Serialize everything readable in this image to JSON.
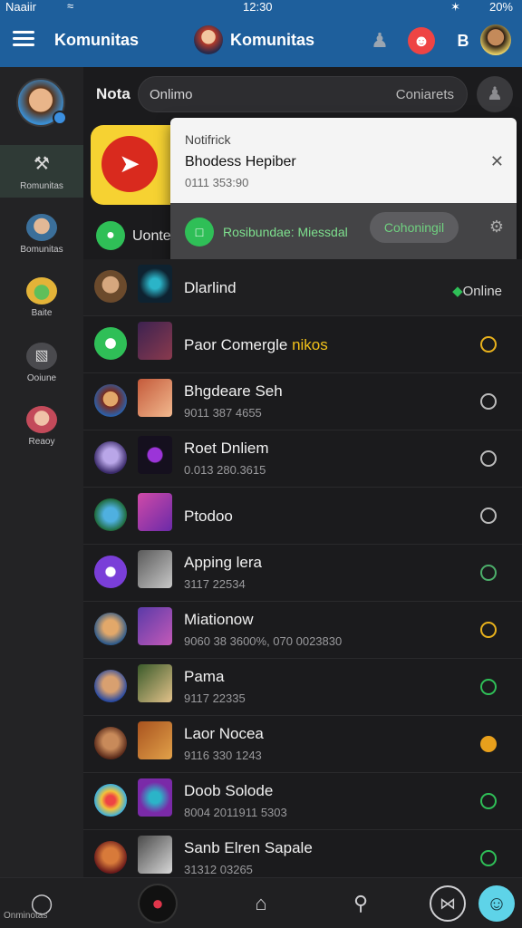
{
  "status_bar": {
    "carrier": "Naaiir",
    "time": "12:30",
    "battery": "20%"
  },
  "header": {
    "menu_label": "Komunitas",
    "title": "Komunitas"
  },
  "rail": {
    "items": [
      {
        "label": "Romunitas",
        "icon": "wrench-icon"
      },
      {
        "label": "Bomunitas",
        "icon": "avatar-icon"
      },
      {
        "label": "Baite",
        "icon": "cowboy-icon"
      },
      {
        "label": "Ooiune",
        "icon": "gamepad-icon"
      },
      {
        "label": "Reaoy",
        "icon": "user-avatar-icon"
      }
    ]
  },
  "search": {
    "label": "Nota",
    "placeholder": "Onlimo",
    "right_text": "Coniarets"
  },
  "section": {
    "label": "Uonte"
  },
  "notification": {
    "kicker": "Notifrick",
    "title": "Bhodess Hepiber",
    "subtitle": "0111 353:90",
    "action_text": "Rosibundae: Miessdal",
    "action_button": "Cohoningil"
  },
  "list_header": {
    "name": "Dlarlind",
    "status": "Online"
  },
  "contacts": [
    {
      "name": "Paor Comergle",
      "highlight": "nikos",
      "sub": "",
      "status_color": "#e8b11c"
    },
    {
      "name": "Bhgdeare Seh",
      "highlight": "",
      "sub": "9011 387 4655",
      "status_color": "#bbbbbb"
    },
    {
      "name": "Roet Dnliem",
      "highlight": "",
      "sub": "0.013 280.3615",
      "status_color": "#bbbbbb"
    },
    {
      "name": "Ptodoo",
      "highlight": "",
      "sub": "",
      "status_color": "#bbbbbb"
    },
    {
      "name": "Apping lera",
      "highlight": "",
      "sub": "3117 22534",
      "status_color": "#4cae6a"
    },
    {
      "name": "Miationow",
      "highlight": "",
      "sub": "9060 38 3600%, 070 0023830",
      "status_color": "#e8b11c"
    },
    {
      "name": "Pama",
      "highlight": "",
      "sub": "9117 22335",
      "status_color": "#2fbf57"
    },
    {
      "name": "Laor Nocea",
      "highlight": "",
      "sub": "9116 330 1243",
      "status_color": "#e8a01c"
    },
    {
      "name": "Doob Solode",
      "highlight": "",
      "sub": "8004 2011911 5303",
      "status_color": "#2fbf57"
    },
    {
      "name": "Sanb Elren Sapale",
      "highlight": "",
      "sub": "31312 03265",
      "status_color": "#2fbf57"
    }
  ],
  "bottom_nav": {
    "label": "Onminotas"
  },
  "colors": {
    "header": "#1e5f9c",
    "accent": "#2fbf57",
    "warning": "#e8b11c"
  }
}
